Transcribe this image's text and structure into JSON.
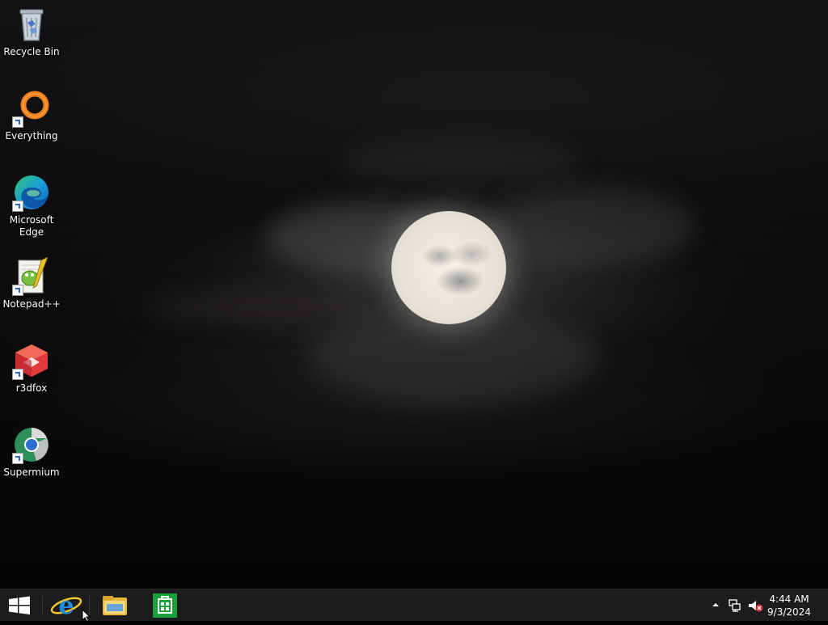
{
  "desktop": {
    "icons": [
      {
        "label": "Recycle Bin",
        "icon": "recycle-bin-icon"
      },
      {
        "label": "Everything",
        "icon": "everything-icon"
      },
      {
        "label": "Microsoft Edge",
        "icon": "edge-icon"
      },
      {
        "label": "Notepad++",
        "icon": "notepad-plus-plus-icon"
      },
      {
        "label": "r3dfox",
        "icon": "r3dfox-icon"
      },
      {
        "label": "Supermium",
        "icon": "supermium-icon"
      }
    ]
  },
  "taskbar": {
    "start": {
      "icon": "windows-logo-icon"
    },
    "pinned": [
      {
        "icon": "internet-explorer-icon"
      },
      {
        "icon": "file-explorer-icon"
      },
      {
        "icon": "store-icon"
      }
    ],
    "tray": {
      "icons": [
        "show-hidden-icons-chevron-icon",
        "network-icon",
        "volume-muted-icon"
      ],
      "time": "4:44 AM",
      "date": "9/3/2024"
    }
  },
  "colors": {
    "taskbar_bg": "#1c1c1e",
    "desktop_text": "#ffffff"
  }
}
